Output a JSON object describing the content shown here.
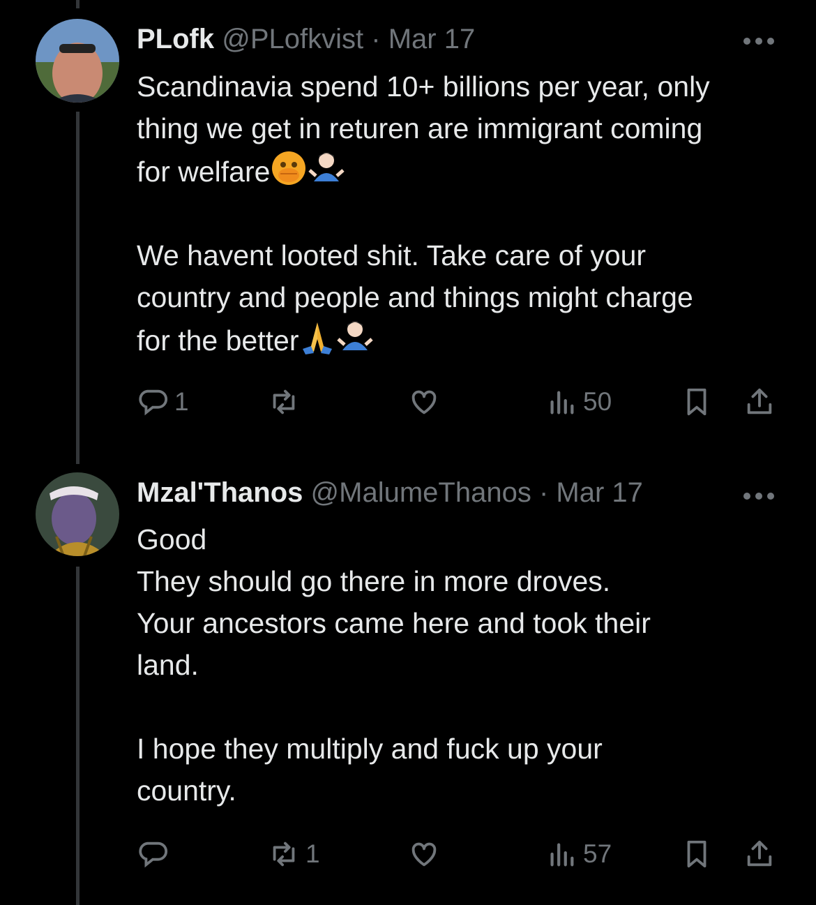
{
  "tweets": [
    {
      "name": "PLofk",
      "handle": "@PLofkvist",
      "dot": "·",
      "date": "Mar 17",
      "paragraphs": [
        [
          "Scandinavia spend 10+ billions per year, only",
          "thing we get in returen are immigrant coming",
          "for welfare"
        ],
        [
          "We havent looted shit. Take care of your",
          "country and people and things might charge",
          "for the better"
        ]
      ],
      "emojis": [
        "face-with-open-eyes-and-hand-over-mouth",
        "person-shrugging",
        "folded-hands",
        "person-shrugging"
      ],
      "stats": {
        "replies": "1",
        "retweets": "",
        "likes": "",
        "views": "50"
      }
    },
    {
      "name": "Mzal'Thanos",
      "handle": "@MalumeThanos",
      "dot": "·",
      "date": "Mar 17",
      "paragraphs": [
        [
          "Good",
          "They should go there in more droves.",
          "Your ancestors came here and took their",
          "land."
        ],
        [
          "I hope they multiply and fuck up your",
          "country."
        ]
      ],
      "stats": {
        "replies": "",
        "retweets": "1",
        "likes": "",
        "views": "57"
      }
    }
  ],
  "colors": {
    "background": "#000000",
    "text": "#e7e9ea",
    "muted": "#71767b",
    "thread": "#333639"
  },
  "icons": [
    "reply-icon",
    "retweet-icon",
    "like-icon",
    "views-icon",
    "bookmark-icon",
    "share-icon",
    "more-icon"
  ]
}
